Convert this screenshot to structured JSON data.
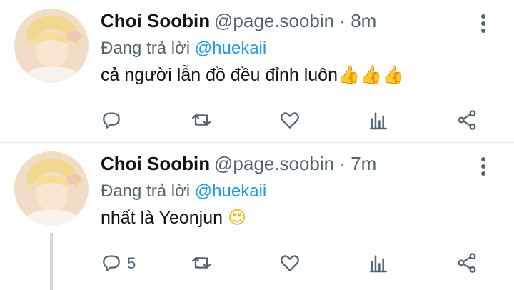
{
  "tweets": [
    {
      "name": "Choi Soobin",
      "handle": "@page.soobin",
      "time": "· 8m",
      "reply_prefix": "Đang trả lời",
      "reply_to": "@huekaii",
      "text": "cả người lẫn đồ đều đỉnh luôn",
      "emojis": "👍👍👍",
      "reply_count": ""
    },
    {
      "name": "Choi Soobin",
      "handle": "@page.soobin",
      "time": "· 7m",
      "reply_prefix": "Đang trả lời",
      "reply_to": "@huekaii",
      "text": "nhất là Yeonjun",
      "emojis": "😍",
      "reply_count": "5"
    }
  ],
  "icons": [
    "reply-icon",
    "retweet-icon",
    "like-icon",
    "analytics-icon",
    "share-icon",
    "more-options-icon"
  ],
  "colors": {
    "mention": "#1d9bf0",
    "secondary_text": "#536471",
    "divider": "#e6ecf0"
  }
}
